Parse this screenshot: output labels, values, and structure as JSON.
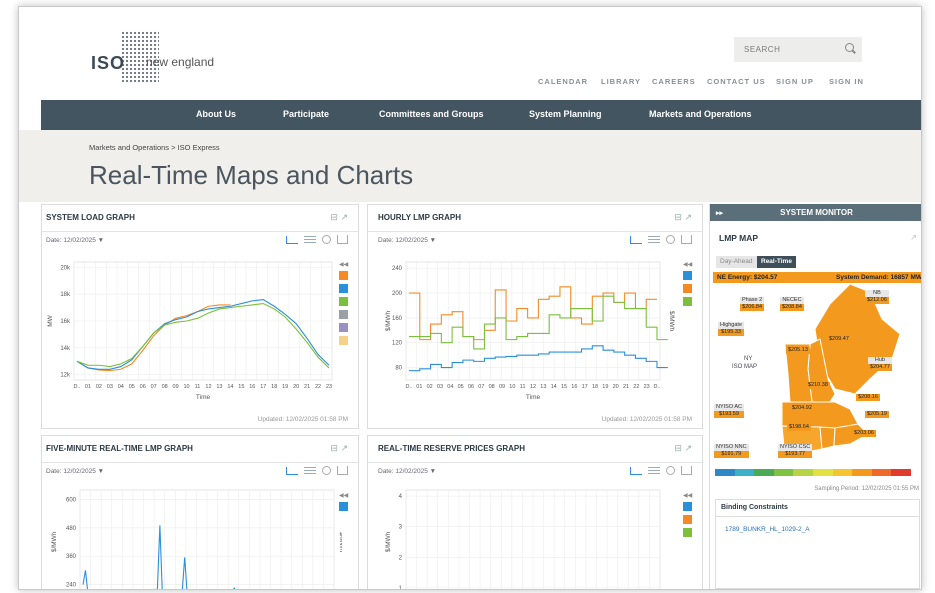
{
  "header": {
    "logo_iso": "ISO",
    "logo_name": "new england",
    "search_placeholder": "SEARCH",
    "links": [
      "CALENDAR",
      "LIBRARY",
      "CAREERS",
      "CONTACT US",
      "SIGN UP",
      "SIGN IN"
    ]
  },
  "nav": [
    "About Us",
    "Participate",
    "Committees and Groups",
    "System Planning",
    "Markets and Operations"
  ],
  "breadcrumb": "Markets and Operations  >  ISO Express",
  "page_title": "Real-Time Maps and Charts",
  "panels": {
    "system_load": {
      "title": "SYSTEM LOAD GRAPH",
      "date": "Date: 12/02/2025 ▼",
      "ylabel": "MW",
      "xlabel": "Time",
      "updated": "Updated: 12/02/2025 01:58 PM"
    },
    "hourly_lmp": {
      "title": "HOURLY LMP GRAPH",
      "date": "Date: 12/02/2025 ▼",
      "ylabel": "$/MWh",
      "ylabel_right": "$/MWh",
      "xlabel": "Time",
      "updated": "Updated: 12/02/2025 01:58 PM"
    },
    "five_minute": {
      "title": "FIVE-MINUTE REAL-TIME LMP GRAPH",
      "date": "Date: 12/02/2025 ▼",
      "ylabel": "$/MWh",
      "ylabel_right": "$/MWh"
    },
    "reserve": {
      "title": "REAL-TIME RESERVE PRICES GRAPH",
      "date": "Date: 12/02/2025 ▼",
      "ylabel": "$/MWh"
    }
  },
  "monitor": {
    "title": "SYSTEM MONITOR",
    "lmp_map_title": "LMP MAP",
    "tab_day_ahead": "Day-Ahead",
    "tab_real_time": "Real-Time",
    "ne_energy": "NE Energy:  $204.57",
    "system_demand": "System Demand:  16857 MW",
    "ny_label": "NY",
    "iso_map_label": "ISO MAP",
    "nodes": [
      {
        "name": "Phase 2",
        "value": "$206.84"
      },
      {
        "name": "NECEC",
        "value": "$208.84"
      },
      {
        "name": "NB",
        "value": "$212.06"
      },
      {
        "name": "Highgate",
        "value": "$195.33"
      },
      {
        "name": "Hub",
        "value": "$204.77"
      },
      {
        "name": "NYISO AC",
        "value": "$193.59"
      },
      {
        "name": "NYISO NNC",
        "value": "$191.79"
      },
      {
        "name": "NYISO CSC",
        "value": "$193.77"
      }
    ],
    "zone_values": [
      "$209.47",
      "$205.13",
      "$210.38",
      "$208.16",
      "$204.92",
      "$205.19",
      "$198.64",
      "$203.06"
    ],
    "sampling_period": "Sampling Period: 12/02/2025 01:55 PM",
    "binding_title": "Binding Constraints",
    "binding_item": "1789_BUNKR_HL_1029-2_A",
    "scale_colors": [
      "#2e88c8",
      "#3cb0c8",
      "#4aaa55",
      "#7fc241",
      "#b6d443",
      "#e3e044",
      "#f5c431",
      "#f39a1e",
      "#ef6a2a",
      "#e23b2e"
    ]
  },
  "chart_data": [
    {
      "type": "line",
      "title": "SYSTEM LOAD GRAPH",
      "xlabel": "Time",
      "ylabel": "MW",
      "x_ticks": [
        "D..",
        "01",
        "02",
        "03",
        "04",
        "05",
        "06",
        "07",
        "08",
        "09",
        "10",
        "11",
        "12",
        "13",
        "14",
        "15",
        "16",
        "17",
        "18",
        "19",
        "20",
        "21",
        "22",
        "23"
      ],
      "y_ticks": [
        "12k",
        "14k",
        "16k",
        "18k",
        "20k"
      ],
      "ylim": [
        11600,
        20400
      ],
      "legend_colors": [
        "#f58a24",
        "#2a90d8",
        "#7bbf3c",
        "#9aa0a6",
        "#9b8fc4",
        "#f7d087"
      ],
      "series": [
        {
          "color": "#f58a24",
          "values": [
            13000,
            12500,
            12350,
            12300,
            12400,
            12800,
            13800,
            14900,
            15700,
            16200,
            16400,
            16700,
            17100,
            17200,
            17200
          ]
        },
        {
          "color": "#2a90d8",
          "values": [
            13000,
            12500,
            12400,
            12400,
            12600,
            13100,
            14100,
            15100,
            15800,
            16100,
            16300,
            16700,
            16900,
            17000,
            17100,
            17300,
            17500,
            17600,
            17100,
            16500,
            15800,
            14700,
            13500,
            12700
          ]
        },
        {
          "color": "#7bbf3c",
          "values": [
            13000,
            12700,
            12700,
            12600,
            12800,
            13200,
            14100,
            15100,
            15700,
            15900,
            16000,
            16200,
            16600,
            16900,
            17000,
            17100,
            17200,
            17300,
            16900,
            16300,
            15400,
            14400,
            13300,
            12500
          ]
        }
      ]
    },
    {
      "type": "line",
      "title": "HOURLY LMP GRAPH",
      "xlabel": "Time",
      "ylabel": "$/MWh",
      "x_ticks": [
        "D..",
        "01",
        "02",
        "03",
        "04",
        "05",
        "06",
        "07",
        "08",
        "09",
        "10",
        "11",
        "12",
        "13",
        "14",
        "15",
        "16",
        "17",
        "18",
        "19",
        "20",
        "21",
        "22",
        "23",
        "D.."
      ],
      "y_ticks": [
        "80",
        "120",
        "160",
        "200",
        "240"
      ],
      "ylim": [
        60,
        250
      ],
      "legend_colors": [
        "#2a90d8",
        "#f58a24",
        "#7bbf3c"
      ],
      "series": [
        {
          "color": "#f58a24",
          "values": [
            200,
            125,
            150,
            165,
            170,
            130,
            125,
            140,
            205,
            155,
            175,
            160,
            190,
            195,
            210,
            160,
            150,
            195,
            200,
            185,
            200,
            175,
            190
          ]
        },
        {
          "color": "#7bbf3c",
          "values": [
            130,
            130,
            135,
            120,
            145,
            130,
            110,
            150,
            160,
            125,
            130,
            135,
            135,
            165,
            160,
            175,
            175,
            155,
            195,
            185,
            175,
            175,
            145,
            125
          ]
        },
        {
          "color": "#2a90d8",
          "values": [
            75,
            78,
            85,
            80,
            88,
            92,
            90,
            95,
            97,
            98,
            100,
            100,
            102,
            105,
            105,
            105,
            110,
            115,
            108,
            105,
            100,
            95,
            90,
            80
          ]
        }
      ]
    },
    {
      "type": "line",
      "title": "FIVE-MINUTE REAL-TIME LMP GRAPH",
      "ylabel": "$/MWh",
      "y_ticks": [
        "240",
        "360",
        "480",
        "600"
      ],
      "ylim": [
        200,
        640
      ],
      "legend_colors": [
        "#2a90d8"
      ],
      "series": [
        {
          "color": "#2a90d8",
          "points": [
            [
              0,
              240
            ],
            [
              1,
              300
            ],
            [
              2,
              200
            ],
            [
              30,
              220
            ],
            [
              31,
              490
            ],
            [
              32,
              200
            ],
            [
              40,
              210
            ],
            [
              41,
              355
            ],
            [
              42,
              200
            ],
            [
              60,
              210
            ],
            [
              61,
              225
            ],
            [
              62,
              200
            ]
          ]
        }
      ]
    },
    {
      "type": "line",
      "title": "REAL-TIME RESERVE PRICES GRAPH",
      "ylabel": "$/MWh",
      "y_ticks": [
        "1",
        "2",
        "3",
        "4"
      ],
      "ylim": [
        0.8,
        4.2
      ],
      "legend_colors": [
        "#2a90d8",
        "#f58a24",
        "#7bbf3c"
      ],
      "series": []
    }
  ]
}
